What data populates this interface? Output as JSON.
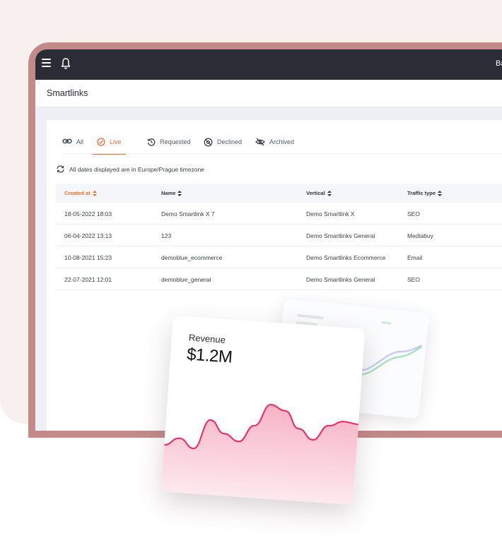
{
  "topbar": {
    "user_fragment": "Ba"
  },
  "page": {
    "title": "Smartlinks"
  },
  "tabs": [
    {
      "label": "All",
      "icon": "link-icon",
      "active": false
    },
    {
      "label": "Live",
      "icon": "check-circle-icon",
      "active": true
    },
    {
      "label": "Requested",
      "icon": "history-icon",
      "active": false
    },
    {
      "label": "Declined",
      "icon": "declined-icon",
      "active": false
    },
    {
      "label": "Archived",
      "icon": "eye-off-icon",
      "active": false
    }
  ],
  "timezone_note": "All dates displayed are in Europe/Prague timezone",
  "table": {
    "columns": [
      "Created at",
      "Name",
      "Vertical",
      "Traffic type"
    ],
    "rows": [
      [
        "18-05-2022 18:03",
        "Demo Smartlink X 7",
        "Demo Smartlink X",
        "SEO"
      ],
      [
        "06-04-2022 13:13",
        "123",
        "Demo Smartlinks General",
        "Mediabuy"
      ],
      [
        "10-08-2021 15:23",
        "demoblue_ecommerce",
        "Demo Smartlinks Ecommerce",
        "Email"
      ],
      [
        "22-07-2021 12:01",
        "demoblue_general",
        "Demo Smartlinks General",
        "SEO"
      ]
    ]
  },
  "revenue_card": {
    "label": "Revenue",
    "value": "$1.2M",
    "line_color": "#e8336a",
    "fill_color": "#f9c4d2",
    "trend": [
      0.22,
      0.31,
      0.2,
      0.55,
      0.4,
      0.32,
      0.52,
      0.78,
      0.72,
      0.52,
      0.4,
      0.58,
      0.64,
      0.62
    ]
  },
  "colors": {
    "accent": "#f26b2d",
    "topbar": "#2a2d36",
    "frame": "#c38a88",
    "background": "#f7f0ef"
  }
}
